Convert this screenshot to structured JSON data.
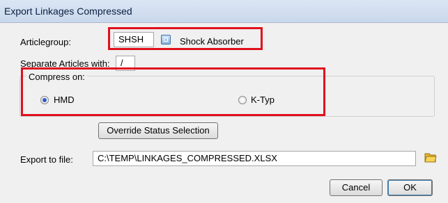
{
  "window": {
    "title": "Export Linkages Compressed"
  },
  "articlegroup": {
    "label": "Articlegroup:",
    "code": "SHSH",
    "name": "Shock Absorber"
  },
  "separate": {
    "label": "Separate Articles with:",
    "value": "/"
  },
  "compress": {
    "legend": "Compress on:",
    "options": [
      {
        "label": "HMD",
        "checked": true
      },
      {
        "label": "K-Typ",
        "checked": false
      }
    ]
  },
  "override_button": {
    "label": "Override Status Selection"
  },
  "export": {
    "label": "Export to file:",
    "path": "C:\\TEMP\\LINKAGES_COMPRESSED.XLSX"
  },
  "buttons": {
    "cancel": "Cancel",
    "ok": "OK"
  },
  "icons": {
    "lookup": "lookup-icon",
    "folder": "folder-open-icon"
  },
  "colors": {
    "highlight": "#e0101c",
    "titlebar": "#c9d8ec"
  }
}
